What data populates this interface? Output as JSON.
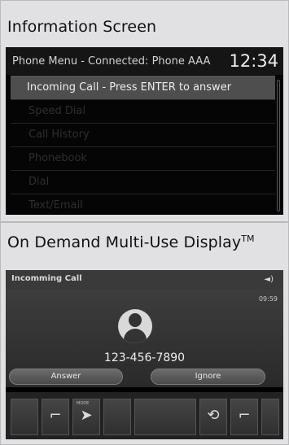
{
  "info_section": {
    "label": "Information Screen",
    "header": {
      "title": "Phone Menu - Connected: Phone AAA",
      "clock": "12:34"
    },
    "menu_items": [
      "Incoming Call - Press ENTER to answer",
      "Speed Dial",
      "Call History",
      "Phonebook",
      "Dial",
      "Text/Email"
    ],
    "selected_index": 0
  },
  "mud_section": {
    "label": "On Demand Multi-Use Display",
    "label_mark": "TM",
    "header": {
      "title": "Incomming Call",
      "icon": "volume-icon"
    },
    "time": "09:59",
    "phone_number": "123-456-7890",
    "buttons": {
      "answer": "Answer",
      "ignore": "Ignore"
    },
    "mode_label": "MODE",
    "controls": [
      "blank-control",
      "seat-heater-left-icon",
      "fan-mode-icon",
      "blank-control",
      "center-control",
      "recirculation-icon",
      "seat-heater-right-icon",
      "blank-control"
    ]
  }
}
